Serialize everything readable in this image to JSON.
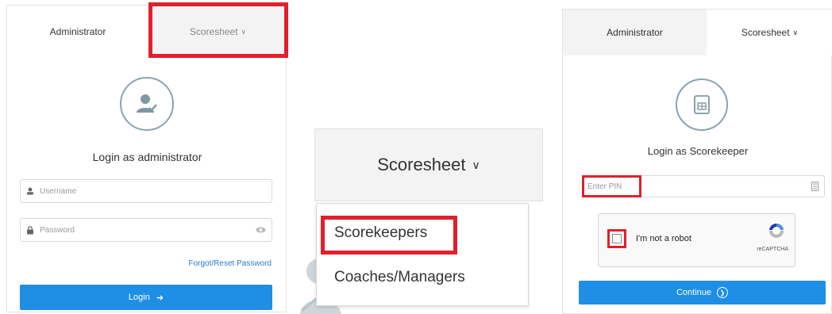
{
  "panel_admin": {
    "tabs": {
      "administrator": "Administrator",
      "scoresheet": "Scoresheet"
    },
    "title": "Login as administrator",
    "username_placeholder": "Username",
    "password_placeholder": "Password",
    "forgot_link": "Forgot/Reset Password",
    "login_button": "Login"
  },
  "panel_dropdown": {
    "header": "Scoresheet",
    "items": [
      "Scorekeepers",
      "Coaches/Managers"
    ]
  },
  "panel_scorekeeper": {
    "tabs": {
      "administrator": "Administrator",
      "scoresheet": "Scoresheet"
    },
    "title": "Login as Scorekeeper",
    "pin_placeholder": "Enter PIN",
    "captcha_label": "I'm not a robot",
    "captcha_brand": "reCAPTCHA",
    "continue_button": "Continue"
  },
  "colors": {
    "highlight": "#e0202b",
    "primary_button": "#1f8fe6",
    "link": "#2a7bd3",
    "inactive_tab": "#f3f3f3"
  }
}
